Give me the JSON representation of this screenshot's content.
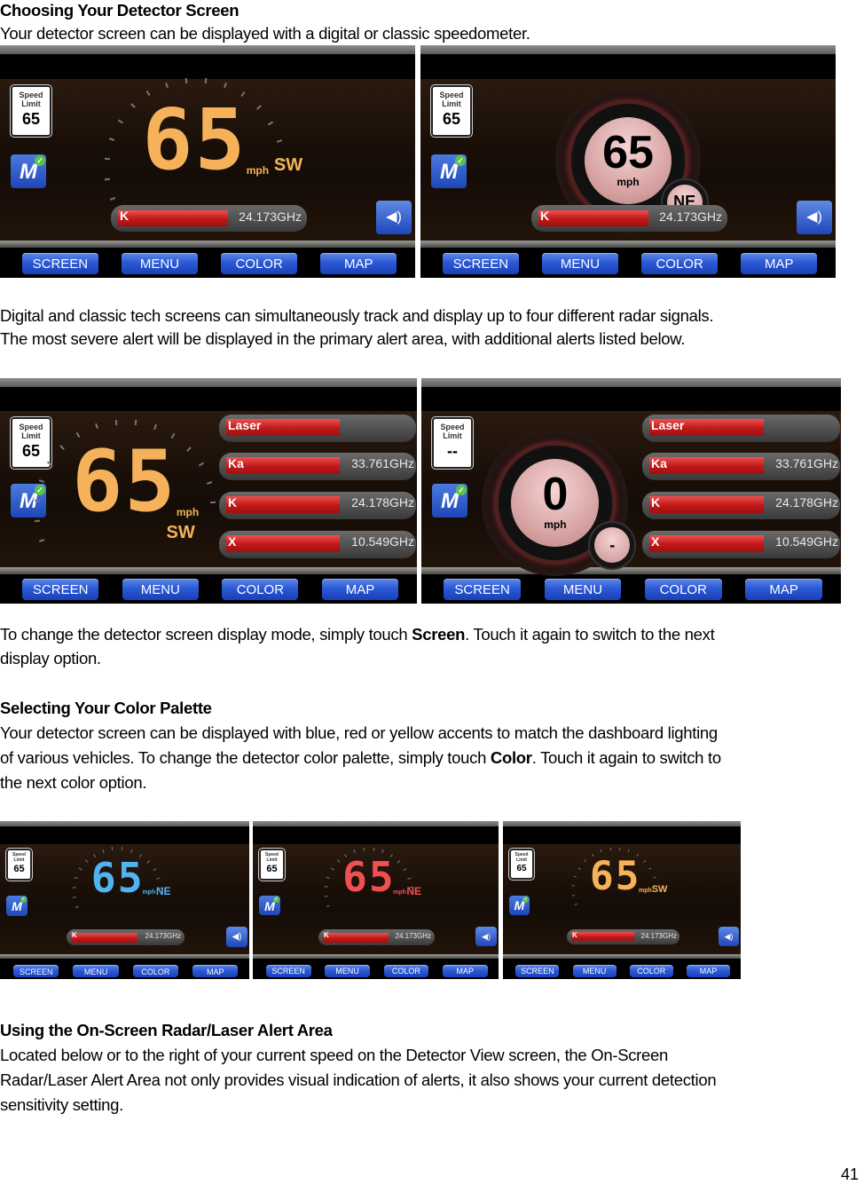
{
  "sections": {
    "detector_screen": {
      "heading": "Choosing Your Detector Screen",
      "intro": "Your detector screen can be displayed with a digital or classic speedometer.",
      "para1_line1": "Digital and classic tech screens can simultaneously track and display up to four different radar signals.",
      "para1_line2": "The most severe alert will be displayed in the primary alert area, with additional alerts listed below.",
      "para2_line1_pre": "To change the detector screen display mode, simply touch ",
      "para2_line1_bold": "Screen",
      "para2_line1_post": ". Touch it again to switch to the next",
      "para2_line2": "display option."
    },
    "color_palette": {
      "heading": "Selecting Your Color Palette",
      "line1": "Your detector screen can be displayed with blue, red or yellow accents to match the dashboard lighting",
      "line2_pre": "of various vehicles. To change the detector color palette, simply touch ",
      "line2_bold": "Color",
      "line2_post": ". Touch it again to switch to",
      "line3": "the next color option."
    },
    "alert_area": {
      "heading": "Using the On-Screen Radar/Laser Alert Area",
      "line1": "Located below or to the right of your current speed on the Detector View screen, the On-Screen",
      "line2": "Radar/Laser Alert Area not only provides visual indication of alerts, it also shows your current detection",
      "line3": "sensitivity setting."
    }
  },
  "page_number": "41",
  "device_ui": {
    "nav_buttons": [
      "SCREEN",
      "MENU",
      "COLOR",
      "MAP"
    ],
    "speed_limit_label_1": "Speed",
    "speed_limit_label_2": "Limit",
    "mph_label": "mph",
    "m_icon_letter": "M",
    "check_glyph": "✓",
    "volume_glyph": "◀)",
    "screens": [
      {
        "style": "digital",
        "speed": "65",
        "limit": "65",
        "heading": "SW",
        "accent": "#f5b25a",
        "alerts": [
          {
            "band": "K",
            "freq": "24.173GHz"
          }
        ]
      },
      {
        "style": "classic",
        "speed": "65",
        "limit": "65",
        "heading": "NE",
        "accent": "#d9a0a0",
        "alerts": [
          {
            "band": "K",
            "freq": "24.173GHz"
          }
        ]
      },
      {
        "style": "digital-multi",
        "speed": "65",
        "limit": "65",
        "heading": "SW",
        "accent": "#f5b25a",
        "alerts": [
          {
            "band": "Laser",
            "freq": ""
          },
          {
            "band": "Ka",
            "freq": "33.761GHz"
          },
          {
            "band": "K",
            "freq": "24.178GHz"
          },
          {
            "band": "X",
            "freq": "10.549GHz"
          }
        ]
      },
      {
        "style": "classic-multi",
        "speed": "0",
        "limit": "--",
        "heading": "-",
        "accent": "#d9a0a0",
        "alerts": [
          {
            "band": "Laser",
            "freq": ""
          },
          {
            "band": "Ka",
            "freq": "33.761GHz"
          },
          {
            "band": "K",
            "freq": "24.178GHz"
          },
          {
            "band": "X",
            "freq": "10.549GHz"
          }
        ]
      },
      {
        "style": "digital-small",
        "palette": "blue",
        "speed": "65",
        "limit": "65",
        "heading": "NE",
        "accent": "#4fb4f0",
        "alerts": [
          {
            "band": "K",
            "freq": "24.173GHz"
          }
        ]
      },
      {
        "style": "digital-small",
        "palette": "red",
        "speed": "65",
        "limit": "65",
        "heading": "NE",
        "accent": "#f05050",
        "alerts": [
          {
            "band": "K",
            "freq": "24.173GHz"
          }
        ]
      },
      {
        "style": "digital-small",
        "palette": "yellow",
        "speed": "65",
        "limit": "65",
        "heading": "SW",
        "accent": "#f5b25a",
        "alerts": [
          {
            "band": "K",
            "freq": "24.173GHz"
          }
        ]
      }
    ]
  }
}
